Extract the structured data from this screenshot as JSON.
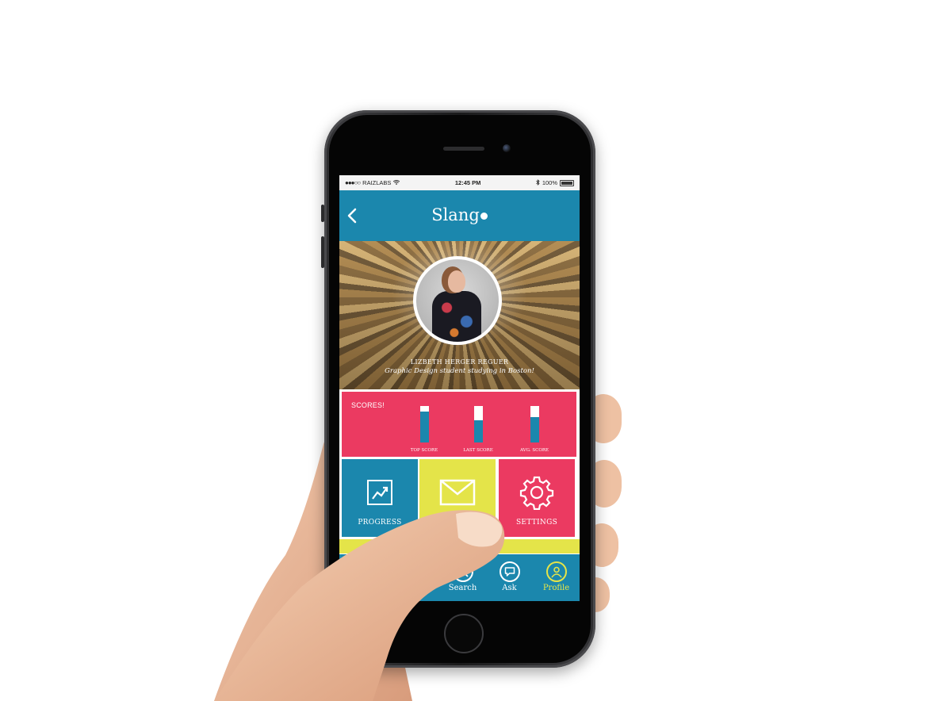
{
  "status": {
    "carrier": "RAIZLABS",
    "time": "12:45 PM",
    "battery": "100%",
    "signal_dots": "●●●○○"
  },
  "nav": {
    "title": "Slang",
    "back_icon": "chevron-left-icon"
  },
  "profile": {
    "name": "LIZBETH HERGER REGUER",
    "bio": "Graphic Design student studying in Boston!"
  },
  "scores": {
    "title": "SCORES!",
    "bars": [
      {
        "label": "TOP SCORE",
        "fill": 0.85
      },
      {
        "label": "LAST SCORE",
        "fill": 0.6
      },
      {
        "label": "AVG. SCORE",
        "fill": 0.7
      }
    ]
  },
  "tiles": {
    "progress": {
      "label": "PROGRESS",
      "icon": "chart-trend-icon"
    },
    "messages": {
      "icon": "envelope-icon"
    },
    "settings": {
      "label": "SETTINGS",
      "icon": "gear-icon"
    }
  },
  "tabs": [
    {
      "label": "Search",
      "icon": "search-icon",
      "active": false
    },
    {
      "label": "Ask",
      "icon": "speech-bubble-icon",
      "active": false
    },
    {
      "label": "Profile",
      "icon": "user-icon",
      "active": true
    }
  ],
  "colors": {
    "blue": "#1b87ad",
    "pink": "#eb3a61",
    "yellow": "#e4e449"
  }
}
